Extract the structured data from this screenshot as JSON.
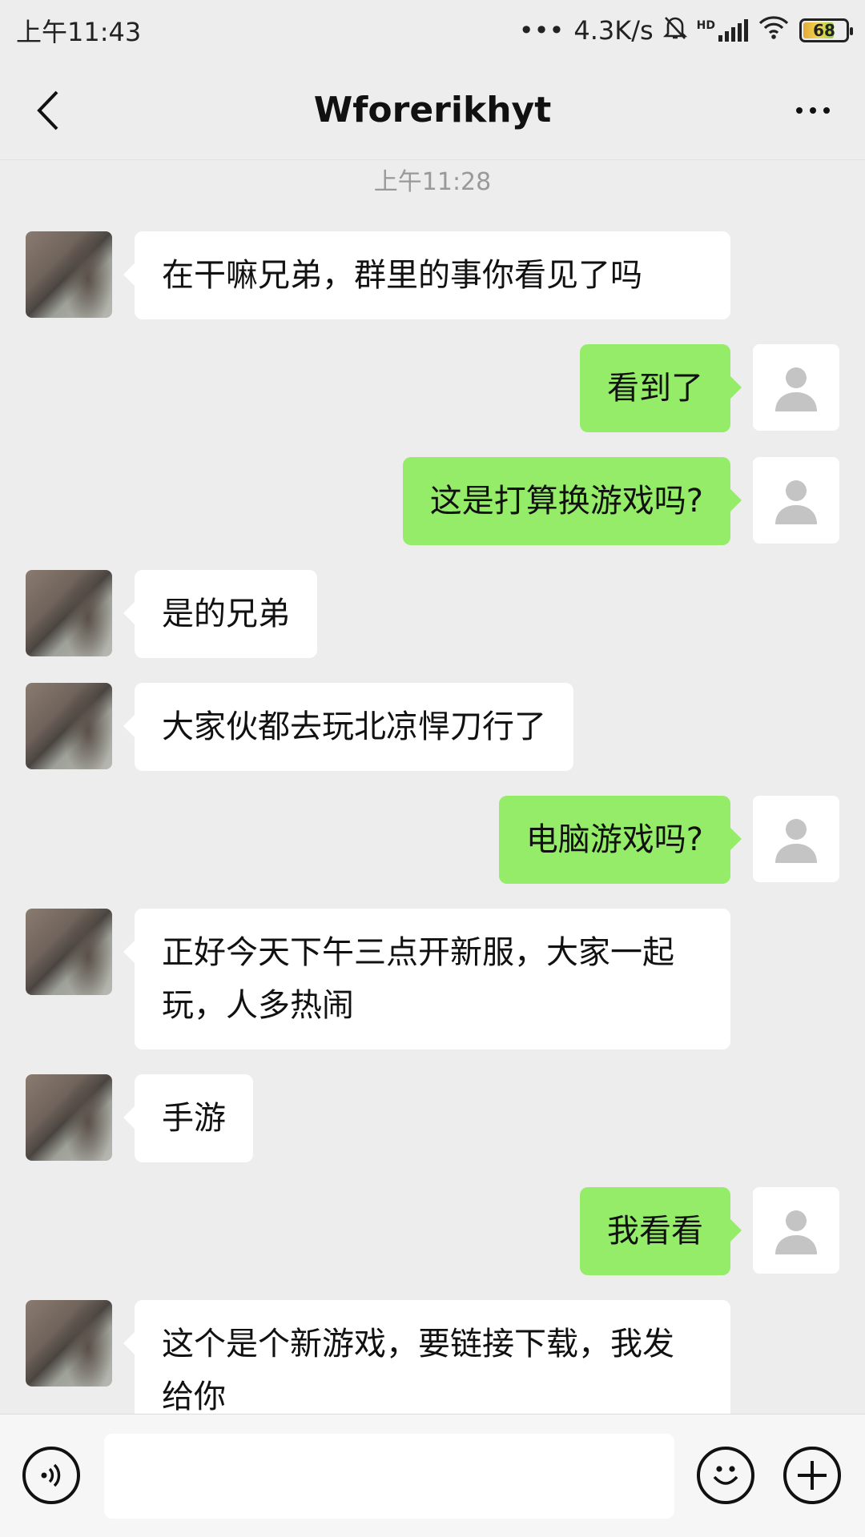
{
  "status_bar": {
    "time": "上午11:43",
    "dots": "•••",
    "net_speed": "4.3K/s",
    "hd_label": "HD",
    "battery": "68",
    "icons": [
      "mute-bell-icon",
      "signal-icon",
      "wifi-icon",
      "battery-icon"
    ]
  },
  "header": {
    "title": "Wforerikhyt",
    "icons": [
      "back-arrow-icon",
      "more-icon"
    ]
  },
  "chat": {
    "timestamp": "上午11:28",
    "messages": [
      {
        "side": "left",
        "text": "在干嘛兄弟，群里的事你看见了吗"
      },
      {
        "side": "right",
        "text": "看到了"
      },
      {
        "side": "right",
        "text": "这是打算换游戏吗?"
      },
      {
        "side": "left",
        "text": "是的兄弟"
      },
      {
        "side": "left",
        "text": "大家伙都去玩北凉悍刀行了"
      },
      {
        "side": "right",
        "text": "电脑游戏吗?"
      },
      {
        "side": "left",
        "text": "正好今天下午三点开新服，大家一起玩，人多热闹"
      },
      {
        "side": "left",
        "text": "手游"
      },
      {
        "side": "right",
        "text": "我看看"
      },
      {
        "side": "left",
        "text": "这个是个新游戏，要链接下载，我发给你"
      }
    ]
  },
  "input_bar": {
    "icons": [
      "voice-icon",
      "emoji-icon",
      "plus-icon"
    ]
  },
  "colors": {
    "background": "#ededed",
    "sent_bubble": "#95ec69",
    "received_bubble": "#ffffff"
  }
}
